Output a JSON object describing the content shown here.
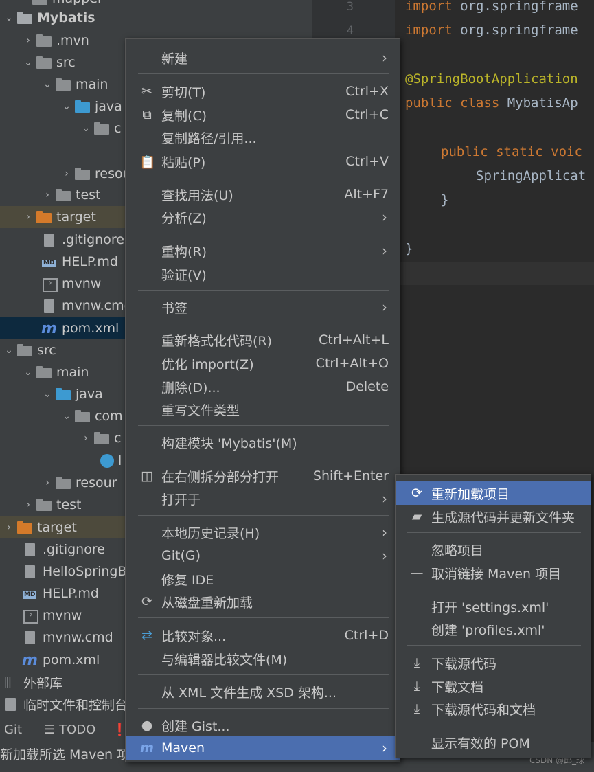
{
  "tree": {
    "rows": [
      {
        "label": "mapper"
      },
      {
        "label": "Mybatis"
      },
      {
        "label": ".mvn"
      },
      {
        "label": "src"
      },
      {
        "label": "main"
      },
      {
        "label": "java"
      },
      {
        "label": "c"
      },
      {
        "label": "resou"
      },
      {
        "label": "test"
      },
      {
        "label": "target"
      },
      {
        "label": ".gitignore"
      },
      {
        "label": "HELP.md"
      },
      {
        "label": "mvnw"
      },
      {
        "label": "mvnw.cmd"
      },
      {
        "label": "pom.xml"
      },
      {
        "label": "src"
      },
      {
        "label": "main"
      },
      {
        "label": "java"
      },
      {
        "label": "com"
      },
      {
        "label": "c"
      },
      {
        "label": "l"
      },
      {
        "label": "resour"
      },
      {
        "label": "test"
      },
      {
        "label": "target"
      },
      {
        "label": ".gitignore"
      },
      {
        "label": "HelloSpringB"
      },
      {
        "label": "HELP.md"
      },
      {
        "label": "mvnw"
      },
      {
        "label": "mvnw.cmd"
      },
      {
        "label": "pom.xml"
      },
      {
        "label": "外部库"
      },
      {
        "label": "临时文件和控制台"
      }
    ]
  },
  "editor": {
    "line_numbers": [
      "3",
      "4"
    ],
    "lines": {
      "l1_kw": "import",
      "l1_rest": " org.springframe",
      "l2_kw": "import",
      "l2_rest": " org.springframe",
      "l3_ann": "@SpringBootApplication",
      "l4_kw": "public class",
      "l4_rest": " MybatisAp",
      "l5_kw": "public static voic",
      "l6": "SpringApplicat",
      "l7": "}",
      "l8": "}"
    }
  },
  "bottombar": {
    "git": "Git",
    "todo_icon": "list-icon",
    "todo": "TODO"
  },
  "status": {
    "text": "新加载所选 Maven 项",
    "watermark": "CSDN @邱_球"
  },
  "menu": {
    "items": {
      "new": {
        "label": "新建"
      },
      "cut": {
        "label": "剪切(T)",
        "shortcut": "Ctrl+X",
        "icon": "scissors-icon"
      },
      "copy": {
        "label": "复制(C)",
        "shortcut": "Ctrl+C",
        "icon": "copy-icon"
      },
      "copy_path": {
        "label": "复制路径/引用..."
      },
      "paste": {
        "label": "粘贴(P)",
        "shortcut": "Ctrl+V",
        "icon": "clipboard-icon"
      },
      "find_usages": {
        "label": "查找用法(U)",
        "shortcut": "Alt+F7"
      },
      "analyze": {
        "label": "分析(Z)"
      },
      "refactor": {
        "label": "重构(R)"
      },
      "validate": {
        "label": "验证(V)"
      },
      "bookmarks": {
        "label": "书签"
      },
      "reformat": {
        "label": "重新格式化代码(R)",
        "shortcut": "Ctrl+Alt+L"
      },
      "optimize": {
        "label": "优化 import(Z)",
        "shortcut": "Ctrl+Alt+O"
      },
      "delete": {
        "label": "删除(D)...",
        "shortcut": "Delete"
      },
      "override_type": {
        "label": "重写文件类型"
      },
      "build_module": {
        "label": "构建模块 'Mybatis'(M)"
      },
      "open_split": {
        "label": "在右侧拆分部分打开",
        "shortcut": "Shift+Enter",
        "icon": "split-icon"
      },
      "open_in": {
        "label": "打开于"
      },
      "local_history": {
        "label": "本地历史记录(H)"
      },
      "git": {
        "label": "Git(G)"
      },
      "repair_ide": {
        "label": "修复 IDE"
      },
      "reload_disk": {
        "label": "从磁盘重新加载",
        "icon": "reload-icon"
      },
      "compare_with": {
        "label": "比较对象...",
        "shortcut": "Ctrl+D",
        "icon": "compare-icon"
      },
      "compare_editor": {
        "label": "与编辑器比较文件(M)"
      },
      "gen_xsd": {
        "label": "从 XML 文件生成 XSD 架构..."
      },
      "create_gist": {
        "label": "创建 Gist...",
        "icon": "github-icon"
      },
      "maven": {
        "label": "Maven",
        "icon": "maven-icon"
      }
    },
    "submenu_arrow": "›"
  },
  "submenu": {
    "items": {
      "reload_project": {
        "label": "重新加载项目",
        "icon": "reload-icon"
      },
      "gen_sources": {
        "label": "生成源代码并更新文件夹",
        "icon": "folder-refresh-icon"
      },
      "ignore": {
        "label": "忽略项目"
      },
      "unlink": {
        "label": "取消链接 Maven 项目",
        "icon": "minus-icon"
      },
      "open_settings": {
        "label": "打开 'settings.xml'"
      },
      "create_profiles": {
        "label": "创建 'profiles.xml'"
      },
      "dl_sources": {
        "label": "下载源代码",
        "icon": "download-icon"
      },
      "dl_docs": {
        "label": "下载文档",
        "icon": "download-icon"
      },
      "dl_both": {
        "label": "下载源代码和文档",
        "icon": "download-icon"
      },
      "effective_pom": {
        "label": "显示有效的 POM"
      }
    }
  }
}
